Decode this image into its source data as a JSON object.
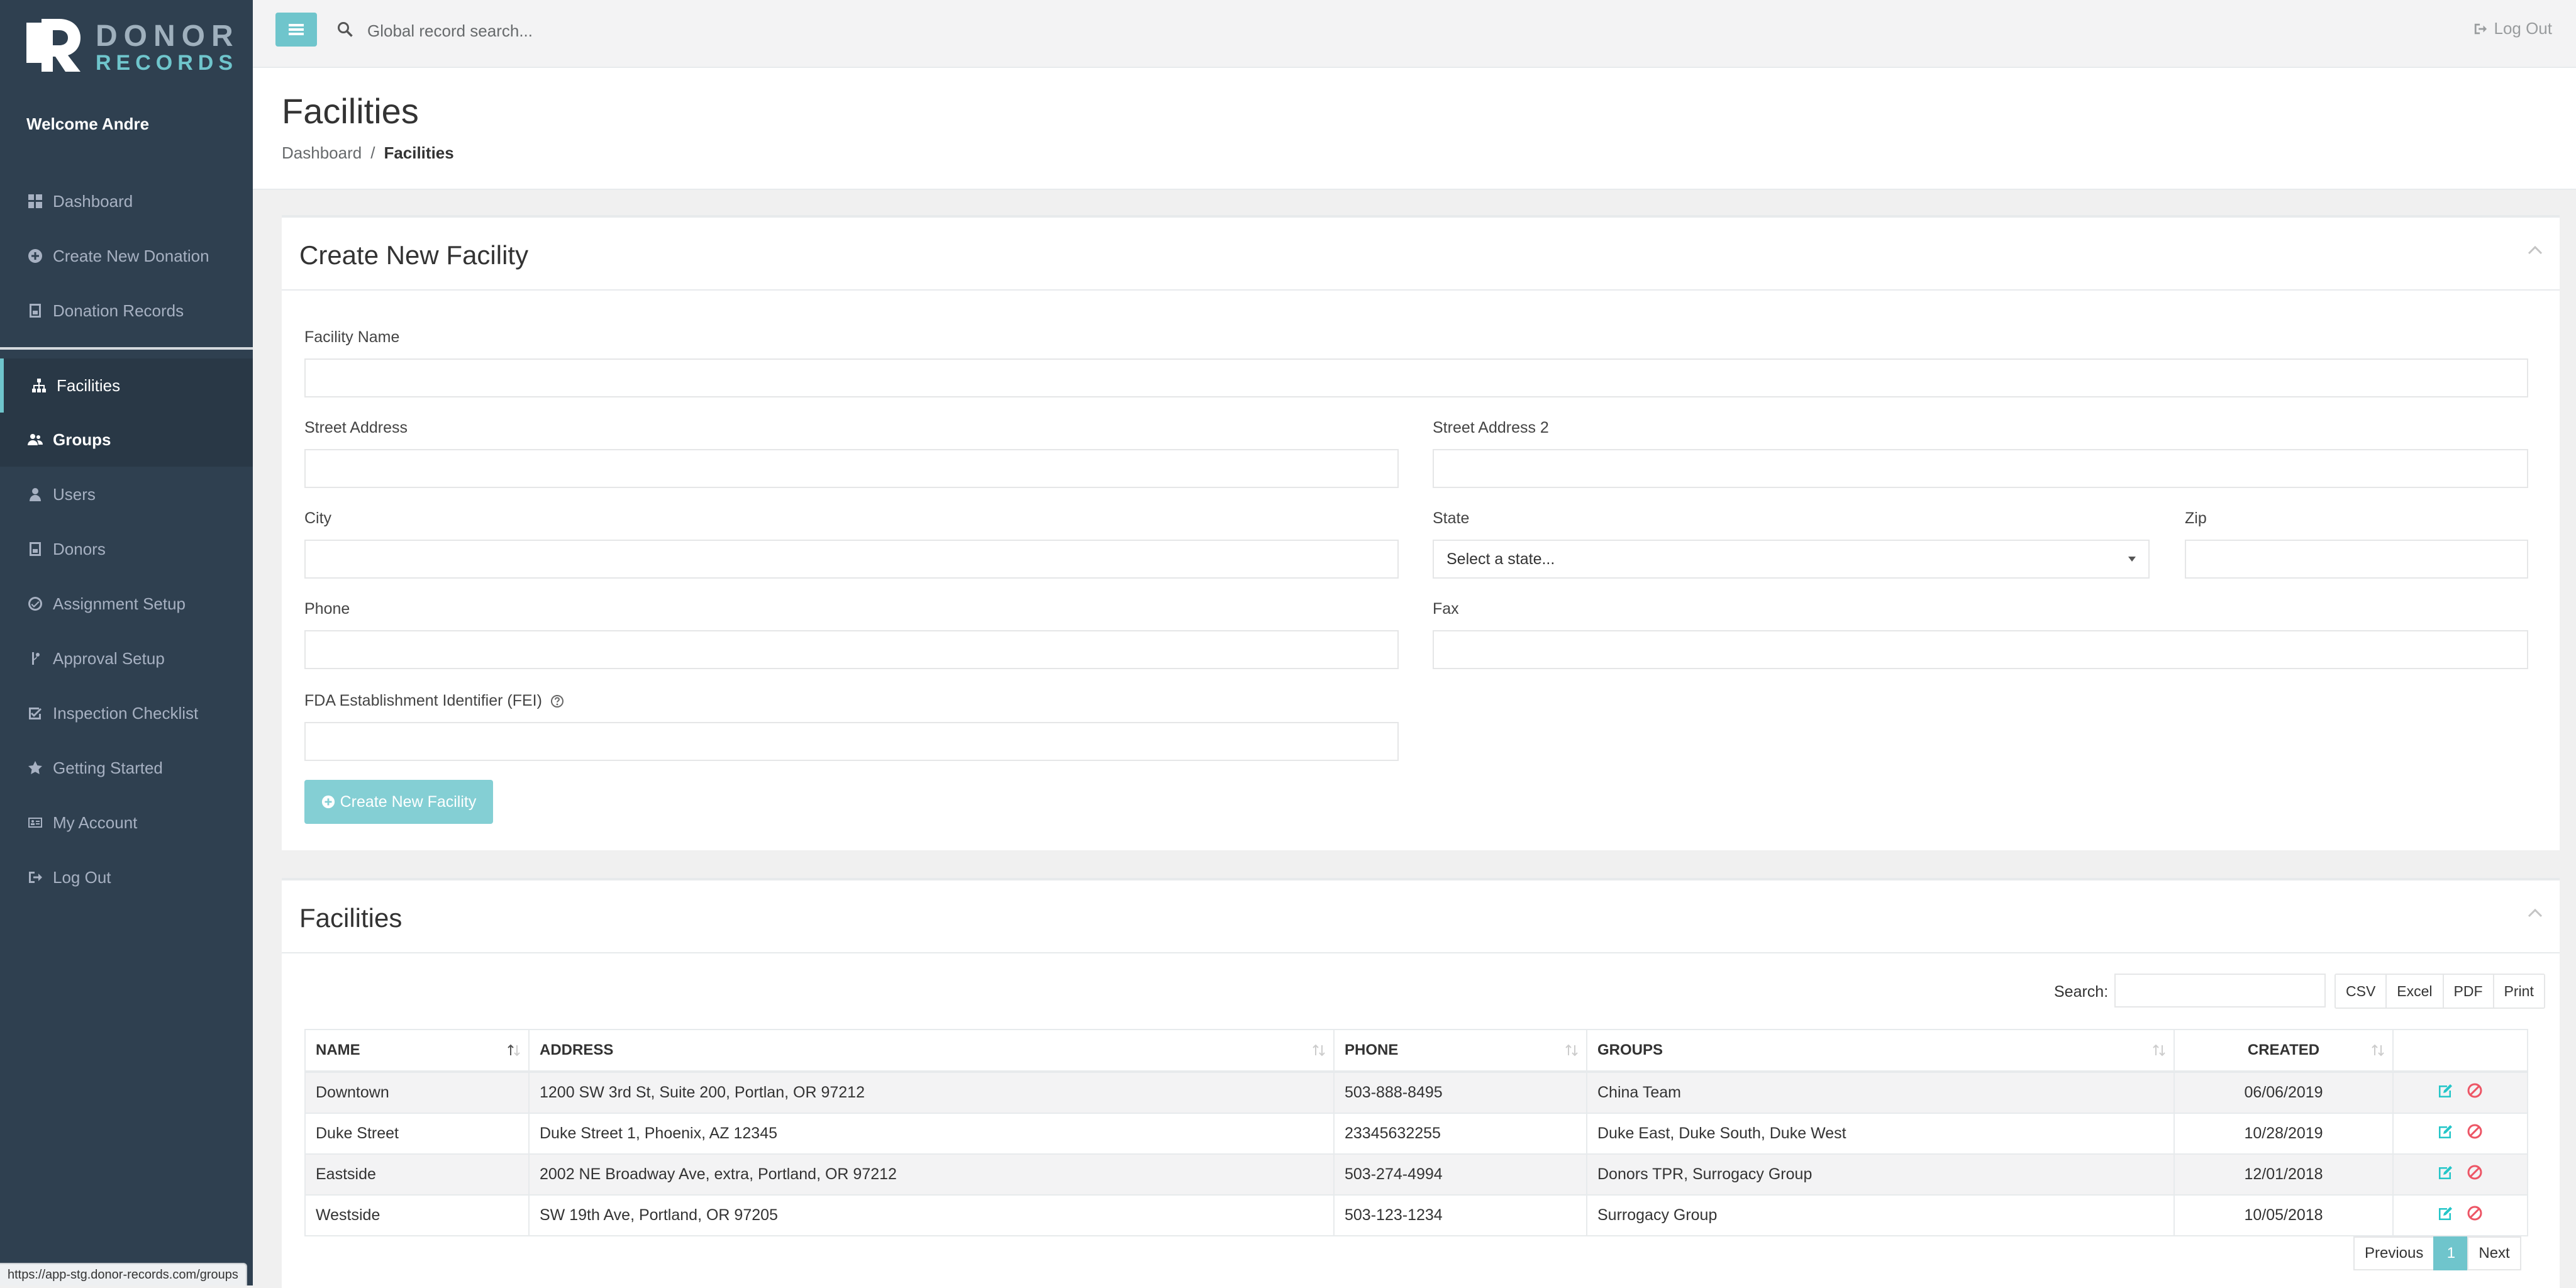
{
  "brand": {
    "line1": "DONOR",
    "line2": "RECORDS"
  },
  "sidebar": {
    "welcome": "Welcome Andre",
    "items": [
      {
        "label": "Dashboard",
        "icon": "dashboard-icon"
      },
      {
        "label": "Create New Donation",
        "icon": "plus-circle-icon"
      },
      {
        "label": "Donation Records",
        "icon": "file-icon"
      },
      {
        "label": "Facilities",
        "icon": "sitemap-icon"
      },
      {
        "label": "Groups",
        "icon": "users-icon"
      },
      {
        "label": "Users",
        "icon": "user-icon"
      },
      {
        "label": "Donors",
        "icon": "file-icon"
      },
      {
        "label": "Assignment Setup",
        "icon": "check-circle-icon"
      },
      {
        "label": "Approval Setup",
        "icon": "branch-icon"
      },
      {
        "label": "Inspection Checklist",
        "icon": "checkbox-icon"
      },
      {
        "label": "Getting Started",
        "icon": "star-icon"
      },
      {
        "label": "My Account",
        "icon": "id-card-icon"
      },
      {
        "label": "Log Out",
        "icon": "sign-out-icon"
      }
    ]
  },
  "topbar": {
    "search_placeholder": "Global record search...",
    "logout": "Log Out"
  },
  "page": {
    "title": "Facilities",
    "breadcrumb": {
      "home": "Dashboard",
      "separator": "/",
      "current": "Facilities"
    }
  },
  "form": {
    "title": "Create New Facility",
    "facility_name": "Facility Name",
    "street_address": "Street Address",
    "street_address2": "Street Address 2",
    "city": "City",
    "state": "State",
    "state_placeholder": "Select a state...",
    "zip": "Zip",
    "phone": "Phone",
    "fax": "Fax",
    "fei": "FDA Establishment Identifier (FEI)",
    "submit": "Create New Facility"
  },
  "facilities": {
    "title": "Facilities",
    "search_label": "Search:",
    "exports": [
      "CSV",
      "Excel",
      "PDF",
      "Print"
    ],
    "columns": [
      "NAME",
      "ADDRESS",
      "PHONE",
      "GROUPS",
      "CREATED"
    ],
    "rows": [
      {
        "name": "Downtown",
        "address": "1200 SW 3rd St, Suite 200, Portlan, OR 97212",
        "phone": "503-888-8495",
        "groups": "China Team",
        "created": "06/06/2019"
      },
      {
        "name": "Duke Street",
        "address": "Duke Street 1, Phoenix, AZ 12345",
        "phone": "23345632255",
        "groups": "Duke East, Duke South, Duke West",
        "created": "10/28/2019"
      },
      {
        "name": "Eastside",
        "address": "2002 NE Broadway Ave, extra, Portland, OR 97212",
        "phone": "503-274-4994",
        "groups": "Donors TPR, Surrogacy Group",
        "created": "12/01/2018"
      },
      {
        "name": "Westside",
        "address": "SW 19th Ave, Portland, OR 97205",
        "phone": "503-123-1234",
        "groups": "Surrogacy Group",
        "created": "10/05/2018"
      }
    ],
    "pagination": {
      "previous": "Previous",
      "current": "1",
      "next": "Next"
    }
  },
  "status_bar": {
    "url": "https://app-stg.donor-records.com/groups"
  },
  "colors": {
    "accent": "#6fc5cc",
    "sidebar": "#2f4050",
    "delete": "#ed5565",
    "edit": "#23c6c8"
  }
}
